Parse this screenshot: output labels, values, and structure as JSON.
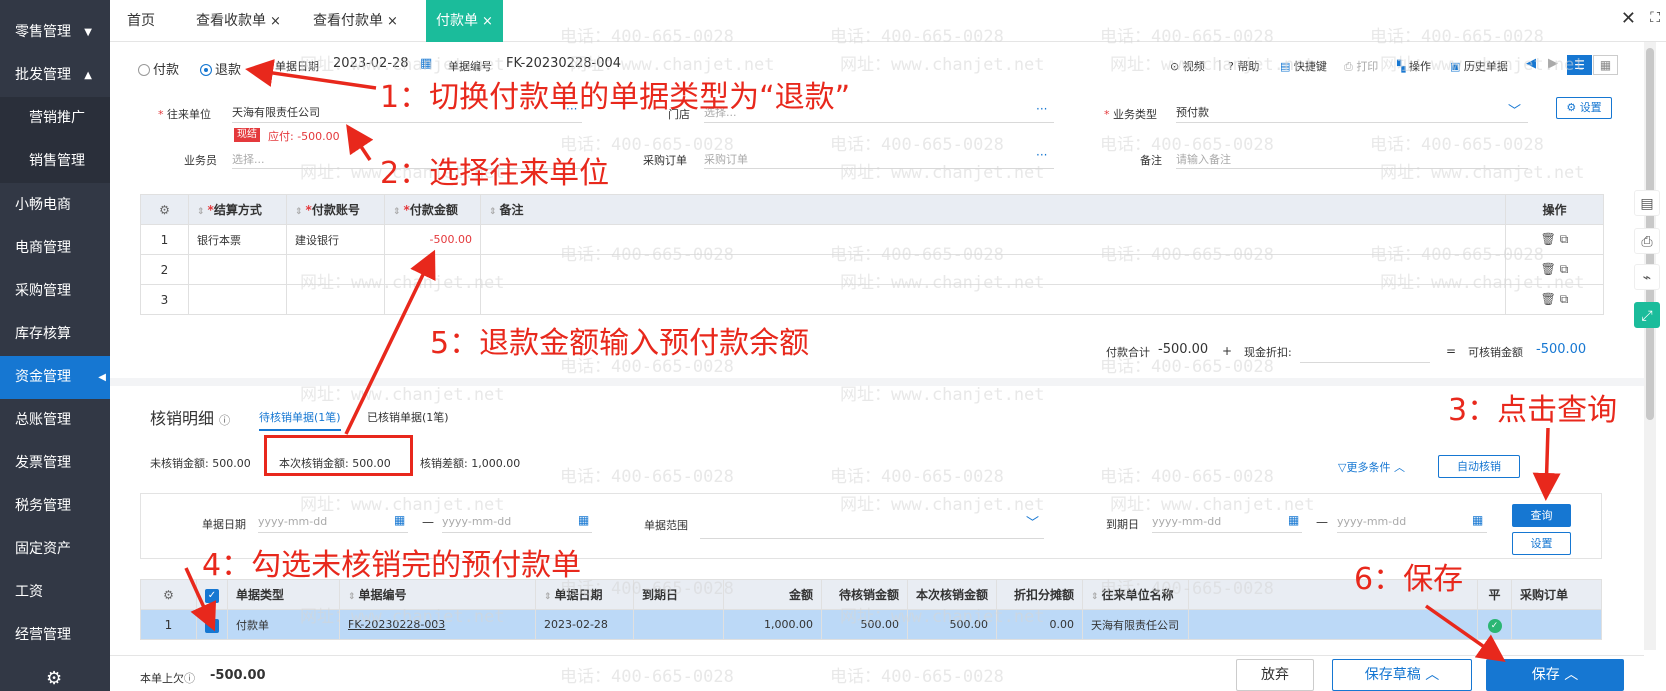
{
  "sidebar": {
    "items": [
      "零售管理",
      "批发管理",
      "营销推广",
      "销售管理",
      "小畅电商",
      "电商管理",
      "采购管理",
      "库存核算",
      "资金管理",
      "总账管理",
      "发票管理",
      "税务管理",
      "固定资产",
      "工资",
      "经营管理"
    ]
  },
  "tabs": {
    "home": "首页",
    "t1": "查看收款单",
    "t2": "查看付款单",
    "t3": "付款单",
    "close": "×"
  },
  "header": {
    "pay": "付款",
    "refund": "退款",
    "date_label": "单据日期",
    "date": "2023-02-28",
    "no_label": "单据编号",
    "no": "FK-20230228-004",
    "tools": {
      "video": "视频",
      "help": "帮助",
      "shortcut": "快捷键",
      "print": "打印",
      "operate": "操作",
      "history": "历史单据"
    }
  },
  "form": {
    "partner_label": "往来单位",
    "partner": "天海有限责任公司",
    "tag": "现结",
    "payable": "应付: -500.00",
    "store_label": "门店",
    "store_ph": "选择...",
    "biz_label": "业务类型",
    "biz": "预付款",
    "settings": "设置",
    "staff_label": "业务员",
    "staff_ph": "选择...",
    "po_label": "采购订单",
    "po_ph": "采购订单",
    "note_label": "备注",
    "note_ph": "请输入备注"
  },
  "grid1": {
    "headers": [
      "结算方式",
      "付款账号",
      "付款金额",
      "备注",
      "操作"
    ],
    "rows": [
      {
        "n": "1",
        "m": "银行本票",
        "a": "建设银行",
        "v": "-500.00"
      },
      {
        "n": "2",
        "m": "",
        "a": "",
        "v": ""
      },
      {
        "n": "3",
        "m": "",
        "a": "",
        "v": ""
      }
    ]
  },
  "totals": {
    "label": "付款合计",
    "value": "-500.00",
    "plus": "+",
    "cash_label": "现金折扣:",
    "eq": "=",
    "can_label": "可核销金额",
    "can": "-500.00"
  },
  "verify": {
    "title": "核销明细",
    "tab_pending": "待核销单据(1笔)",
    "tab_done": "已核销单据(1笔)",
    "unverified": "未核销金额: 500.00",
    "this_amount": "本次核销金额: 500.00",
    "diff": "核销差额: 1,000.00",
    "more": "更多条件",
    "auto": "自动核销",
    "query": "查询",
    "set": "设置",
    "date_label": "单据日期",
    "date_ph1": "yyyy-mm-dd",
    "date_ph2": "yyyy-mm-dd",
    "dash": "—",
    "range_label": "单据范围",
    "due_label": "到期日",
    "due_ph1": "yyyy-mm-dd",
    "due_ph2": "yyyy-mm-dd"
  },
  "grid2": {
    "headers": [
      "单据类型",
      "单据编号",
      "单据日期",
      "到期日",
      "金额",
      "待核销金额",
      "本次核销金额",
      "折扣分摊额",
      "往来单位名称",
      "平",
      "采购订单"
    ],
    "row": {
      "n": "1",
      "type": "付款单",
      "no": "FK-20230228-003",
      "date": "2023-02-28",
      "due": "",
      "amount": "1,000.00",
      "pending": "500.00",
      "this": "500.00",
      "discount": "0.00",
      "partner": "天海有限责任公司"
    }
  },
  "footer": {
    "owe_label": "本单上欠",
    "owe": "-500.00",
    "abandon": "放弃",
    "draft": "保存草稿",
    "save": "保存"
  },
  "annotations": {
    "a1": "1：切换付款单的单据类型为“退款”",
    "a2": "2：选择往来单位",
    "a3": "3：点击查询",
    "a4": "4：勾选未核销完的预付款单",
    "a5": "5：退款金额输入预付款余额",
    "a6": "6：保存"
  },
  "watermark": {
    "phone": "电话：400-665-0028",
    "site": "网址：www.chanjet.net"
  },
  "colors": {
    "accent": "#1677d2",
    "tab_active": "#1bbc9b",
    "annotation": "#e8281c",
    "selected_row": "#bcd9f7"
  }
}
